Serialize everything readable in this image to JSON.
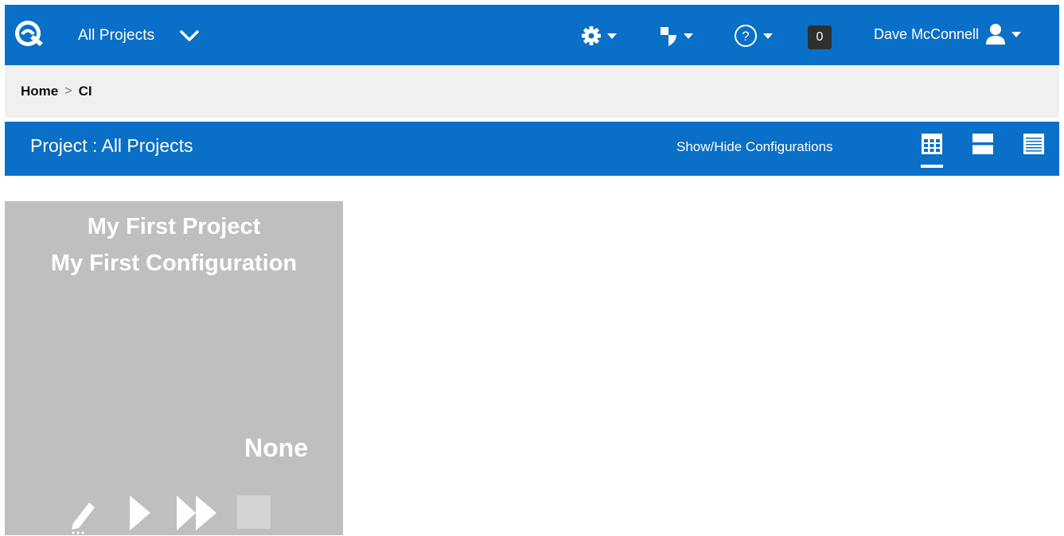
{
  "header": {
    "project_selector": "All Projects",
    "notifications_count": "0",
    "user_name": "Dave McConnell",
    "icons": {
      "logo": "cyclone-logo",
      "settings": "gear-icon",
      "security": "shield-icon",
      "help": "help-icon",
      "user": "user-icon"
    }
  },
  "breadcrumb": {
    "home": "Home",
    "separator": ">",
    "current": "CI"
  },
  "project_bar": {
    "title": "Project : All Projects",
    "toggle_label": "Show/Hide Configurations",
    "view_modes": [
      "grid-view-icon",
      "split-view-icon",
      "list-view-icon"
    ]
  },
  "tiles": [
    {
      "project": "My First Project",
      "configuration": "My First Configuration",
      "status": "None",
      "actions": [
        "edit-icon",
        "play-icon",
        "fast-forward-icon",
        "stop-icon"
      ]
    }
  ],
  "colors": {
    "brand_blue": "#0a6fc6",
    "breadcrumb_bg": "#f0f0f0",
    "tile_bg": "#bfbfbf",
    "badge_bg": "#2f2f2f"
  }
}
